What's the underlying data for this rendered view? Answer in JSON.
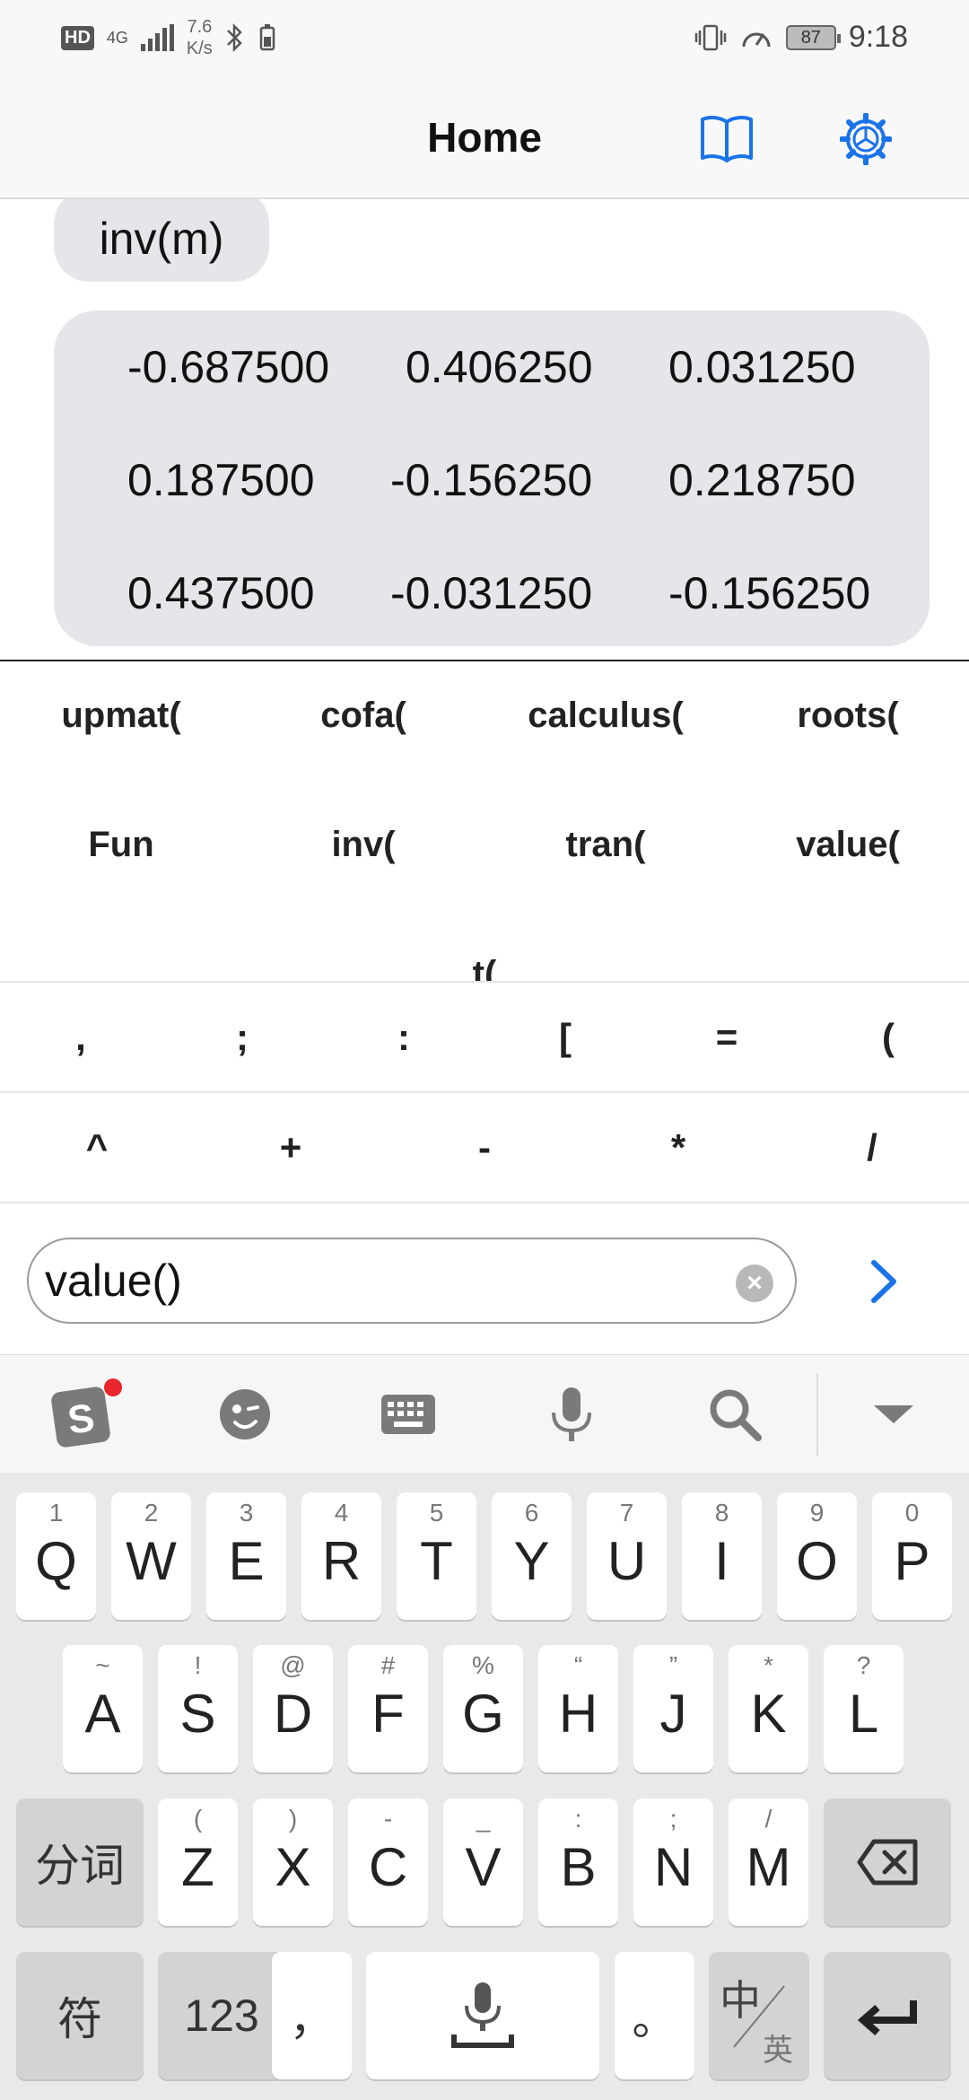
{
  "status_bar": {
    "hd_label": "HD",
    "network": "4G",
    "speed_value": "7.6",
    "speed_unit": "K/s",
    "battery": "87",
    "time": "9:18"
  },
  "nav": {
    "title": "Home",
    "accent_color": "#1a73e8"
  },
  "conversation": {
    "query": "inv(m)",
    "matrix": [
      [
        "-0.687500",
        "0.406250",
        "0.031250"
      ],
      [
        "0.187500",
        "-0.156250",
        "0.218750"
      ],
      [
        "0.437500",
        "-0.031250",
        "-0.156250"
      ]
    ]
  },
  "functions": [
    [
      "upmat(",
      "cofa(",
      "calculus(",
      "roots("
    ],
    [
      "Fun",
      "inv(",
      "tran(",
      "value("
    ],
    [
      "t("
    ]
  ],
  "symbols_row1": [
    ",",
    ";",
    ":",
    "[",
    "=",
    "("
  ],
  "symbols_row2": [
    "^",
    "+",
    "-",
    "*",
    "/"
  ],
  "input": {
    "value": "value()",
    "clear_icon": "clear-icon",
    "send_icon": "chevron-right-icon"
  },
  "keyboard": {
    "toolbar_icons": [
      "sogou-logo-icon",
      "emoji-icon",
      "keyboard-icon",
      "microphone-icon",
      "search-icon",
      "collapse-icon"
    ],
    "row1": [
      {
        "hint": "1",
        "key": "Q"
      },
      {
        "hint": "2",
        "key": "W"
      },
      {
        "hint": "3",
        "key": "E"
      },
      {
        "hint": "4",
        "key": "R"
      },
      {
        "hint": "5",
        "key": "T"
      },
      {
        "hint": "6",
        "key": "Y"
      },
      {
        "hint": "7",
        "key": "U"
      },
      {
        "hint": "8",
        "key": "I"
      },
      {
        "hint": "9",
        "key": "O"
      },
      {
        "hint": "0",
        "key": "P"
      }
    ],
    "row2": [
      {
        "hint": "~",
        "key": "A"
      },
      {
        "hint": "!",
        "key": "S"
      },
      {
        "hint": "@",
        "key": "D"
      },
      {
        "hint": "#",
        "key": "F"
      },
      {
        "hint": "%",
        "key": "G"
      },
      {
        "hint": "“",
        "key": "H"
      },
      {
        "hint": "”",
        "key": "J"
      },
      {
        "hint": "*",
        "key": "K"
      },
      {
        "hint": "?",
        "key": "L"
      }
    ],
    "row3": [
      {
        "hint": "(",
        "key": "Z"
      },
      {
        "hint": ")",
        "key": "X"
      },
      {
        "hint": "-",
        "key": "C"
      },
      {
        "hint": "_",
        "key": "V"
      },
      {
        "hint": ":",
        "key": "B"
      },
      {
        "hint": ";",
        "key": "N"
      },
      {
        "hint": "/",
        "key": "M"
      }
    ],
    "segment_label": "分词",
    "symbol_label": "符",
    "numeric_label": "123",
    "comma_label": "，",
    "period_label": "。",
    "lang_main": "中",
    "lang_alt": "英"
  }
}
